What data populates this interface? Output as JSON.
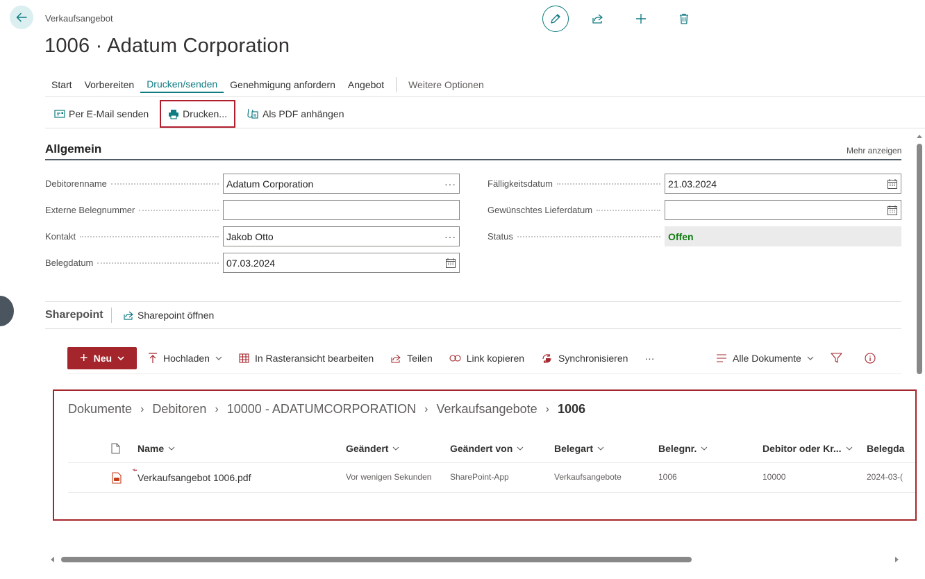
{
  "header": {
    "record_type": "Verkaufsangebot",
    "title": "1006 · Adatum Corporation"
  },
  "tabs": [
    {
      "label": "Start",
      "active": false
    },
    {
      "label": "Vorbereiten",
      "active": false
    },
    {
      "label": "Drucken/senden",
      "active": true
    },
    {
      "label": "Genehmigung anfordern",
      "active": false
    },
    {
      "label": "Angebot",
      "active": false
    }
  ],
  "more_options": "Weitere Optionen",
  "actions": {
    "email": "Per E-Mail senden",
    "print": "Drucken...",
    "pdf": "Als PDF anhängen"
  },
  "general": {
    "title": "Allgemein",
    "more": "Mehr anzeigen",
    "left_fields": [
      {
        "label": "Debitorenname",
        "value": "Adatum Corporation",
        "control": "lookup"
      },
      {
        "label": "Externe Belegnummer",
        "value": "",
        "control": "text"
      },
      {
        "label": "Kontakt",
        "value": "Jakob Otto",
        "control": "lookup"
      },
      {
        "label": "Belegdatum",
        "value": "07.03.2024",
        "control": "date"
      }
    ],
    "right_fields": [
      {
        "label": "Fälligkeitsdatum",
        "value": "21.03.2024",
        "control": "date"
      },
      {
        "label": "Gewünschtes Lieferdatum",
        "value": "",
        "control": "date"
      },
      {
        "label": "Status",
        "value": "Offen",
        "control": "status"
      }
    ]
  },
  "sharepoint": {
    "title": "Sharepoint",
    "open": "Sharepoint öffnen",
    "commands": {
      "new": "Neu",
      "upload": "Hochladen",
      "grid": "In Rasteransicht bearbeiten",
      "share": "Teilen",
      "copy_link": "Link kopieren",
      "sync": "Synchronisieren",
      "more": "···",
      "view": "Alle Dokumente"
    },
    "breadcrumb": [
      "Dokumente",
      "Debitoren",
      "10000 - ADATUMCORPORATION",
      "Verkaufsangebote",
      "1006"
    ],
    "columns": [
      "Name",
      "Geändert",
      "Geändert von",
      "Belegart",
      "Belegnr.",
      "Debitor oder Kr...",
      "Belegda"
    ],
    "rows": [
      {
        "name": "Verkaufsangebot 1006.pdf",
        "modified": "Vor wenigen Sekunden",
        "modified_by": "SharePoint-App",
        "doc_type": "Verkaufsangebote",
        "doc_no": "1006",
        "customer": "10000",
        "doc_date": "2024-03-("
      }
    ]
  },
  "colors": {
    "accent": "#0f7b82",
    "highlight": "#b01e2e",
    "new_button": "#a4262c",
    "status": "#107c10"
  }
}
